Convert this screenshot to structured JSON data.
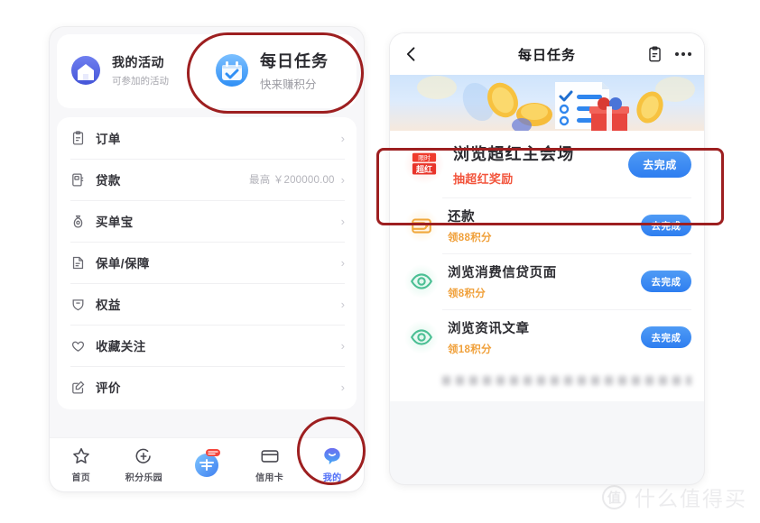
{
  "left_phone": {
    "activity_cards": [
      {
        "title": "我的活动",
        "subtitle": "可参加的活动",
        "icon": "avatar-house-icon"
      },
      {
        "title": "每日任务",
        "subtitle": "快来赚积分",
        "icon": "calendar-check-icon"
      }
    ],
    "menu": [
      {
        "label": "订单",
        "value": "",
        "icon": "clipboard-icon",
        "chevron": "›"
      },
      {
        "label": "贷款",
        "value": "最高 ￥200000.00",
        "icon": "loan-doc-icon",
        "chevron": "›"
      },
      {
        "label": "买单宝",
        "value": "",
        "icon": "money-bag-icon",
        "chevron": "›"
      },
      {
        "label": "保单/保障",
        "value": "",
        "icon": "policy-doc-icon",
        "chevron": "›"
      },
      {
        "label": "权益",
        "value": "",
        "icon": "shield-tag-icon",
        "chevron": "›"
      },
      {
        "label": "收藏关注",
        "value": "",
        "icon": "heart-icon",
        "chevron": "›"
      },
      {
        "label": "评价",
        "value": "",
        "icon": "edit-square-icon",
        "chevron": "›"
      }
    ],
    "tabbar": [
      {
        "label": "首页",
        "icon": "star-home-icon",
        "active": false
      },
      {
        "label": "积分乐园",
        "icon": "points-icon",
        "active": false
      },
      {
        "label": "",
        "icon": "center-mai-icon",
        "active": false
      },
      {
        "label": "信用卡",
        "icon": "credit-card-icon",
        "active": false
      },
      {
        "label": "我的",
        "icon": "profile-icon",
        "active": true
      }
    ]
  },
  "right_phone": {
    "navbar": {
      "back_icon": "chevron-left-icon",
      "title": "每日任务",
      "clipboard_icon": "clipboard-icon",
      "more_icon": "more-dots-icon"
    },
    "banner": {
      "alt": "coins-checklist-giftbox-banner"
    },
    "tasks": [
      {
        "title": "浏览超红主会场",
        "subtitle": "抽超红奖励",
        "subtitle_style": "red",
        "button": "去完成",
        "icon": "chaohong-badge-icon",
        "icon_tone": "redb",
        "hero": true
      },
      {
        "title": "还款",
        "subtitle": "领88积分",
        "subtitle_style": "amber",
        "button": "去完成",
        "icon": "wallet-icon",
        "icon_tone": "warm",
        "hero": false
      },
      {
        "title": "浏览消费信贷页面",
        "subtitle": "领8积分",
        "subtitle_style": "amber",
        "button": "去完成",
        "icon": "eye-icon",
        "icon_tone": "mint",
        "hero": false
      },
      {
        "title": "浏览资讯文章",
        "subtitle": "领18积分",
        "subtitle_style": "amber",
        "button": "去完成",
        "icon": "eye-icon",
        "icon_tone": "mint",
        "hero": false
      }
    ]
  },
  "annotations": {
    "color": "#9d1f20",
    "shapes": [
      {
        "name": "daily-task-card-highlight",
        "kind": "pill"
      },
      {
        "name": "profile-tab-highlight",
        "kind": "circle"
      },
      {
        "name": "hero-task-highlight",
        "kind": "rect"
      }
    ]
  },
  "watermark": {
    "logo": "值",
    "text": "什么值得买"
  },
  "colors": {
    "accent_blue": "#2e7ef0",
    "amber": "#f0a03a",
    "red": "#f2553d",
    "annotation_red": "#9d1f20"
  }
}
